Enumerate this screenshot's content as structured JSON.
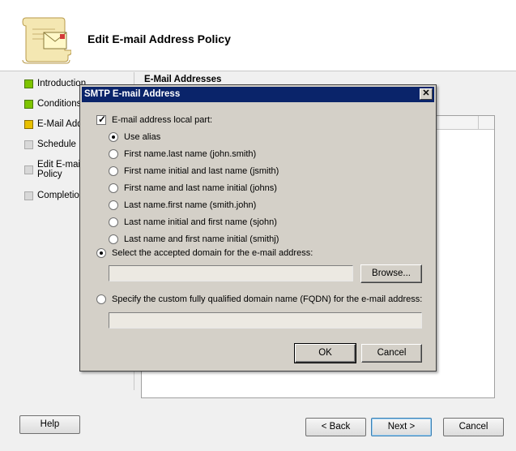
{
  "wizard": {
    "title": "Edit E-mail Address Policy",
    "steps": [
      {
        "label": "Introduction",
        "status": "complete"
      },
      {
        "label": "Conditions",
        "status": "complete"
      },
      {
        "label": "E-Mail Add",
        "status": "current"
      },
      {
        "label": "Schedule",
        "status": "pending"
      },
      {
        "label": "Edit E-mai",
        "label2": "Policy",
        "status": "pending"
      },
      {
        "label": "Completion",
        "status": "pending"
      }
    ],
    "right_heading": "E-Mail Addresses",
    "buttons": {
      "help": "Help",
      "back": "< Back",
      "next": "Next >",
      "cancel": "Cancel"
    }
  },
  "dialog": {
    "title": "SMTP E-mail Address",
    "close_glyph": "✕",
    "local_part": {
      "label": "E-mail address local part:",
      "checked": true
    },
    "local_options": [
      {
        "label": "Use alias",
        "selected": true
      },
      {
        "label": "First name.last name (john.smith)",
        "selected": false
      },
      {
        "label": "First name initial and last name (jsmith)",
        "selected": false
      },
      {
        "label": "First name and last name initial (johns)",
        "selected": false
      },
      {
        "label": "Last name.first name (smith.john)",
        "selected": false
      },
      {
        "label": "Last name initial and first name (sjohn)",
        "selected": false
      },
      {
        "label": "Last name and first name initial (smithj)",
        "selected": false
      }
    ],
    "accepted_domain": {
      "label": "Select the accepted domain for the e-mail address:",
      "selected": true,
      "value": "",
      "browse": "Browse..."
    },
    "custom_fqdn": {
      "label": "Specify the custom fully qualified domain name (FQDN) for the e-mail address:",
      "selected": false,
      "value": ""
    },
    "ok": "OK",
    "cancel": "Cancel"
  },
  "colors": {
    "titlebar": "#0a246a",
    "step_complete": "#7ec400",
    "step_current": "#e8c000"
  }
}
